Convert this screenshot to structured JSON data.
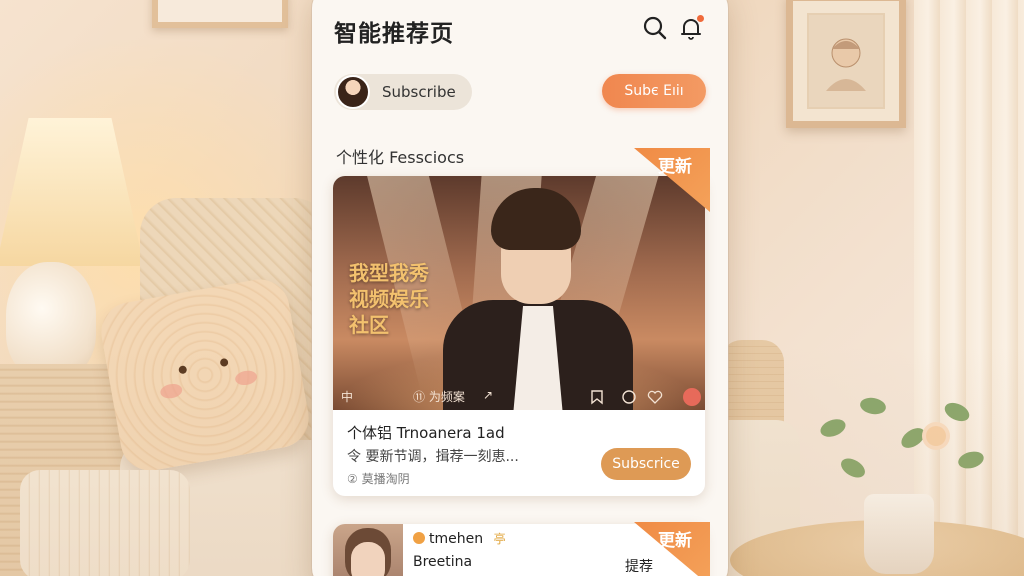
{
  "header": {
    "title": "智能推荐页",
    "search_icon": "search-icon",
    "bell_icon": "bell-icon"
  },
  "subscription_row": {
    "pill_label": "Subscribe",
    "button_label": "Subє Eıiı"
  },
  "section": {
    "title": "个性化 Fessciocs"
  },
  "featured_card": {
    "ribbon_label": "更新",
    "overlay_lines": [
      "我型我秀",
      "视频娱乐",
      "社区"
    ],
    "controls": [
      "中",
      "⑪ 为频案",
      "↗"
    ],
    "title": "个体铝 Trnoanera 1ad",
    "description": "令 要新节调，揖荐一刻恵...",
    "meta": "② 莫播淘阴",
    "button_label": "Subscrice"
  },
  "second_card": {
    "ribbon_label": "更新",
    "name": "tmehen",
    "name_suffix": "亭",
    "subtitle": "Breetina",
    "action": "提荐"
  },
  "colors": {
    "accent_orange": "#f0874f",
    "card_button": "#de9a55",
    "overlay_gold": "#f3c16e"
  }
}
